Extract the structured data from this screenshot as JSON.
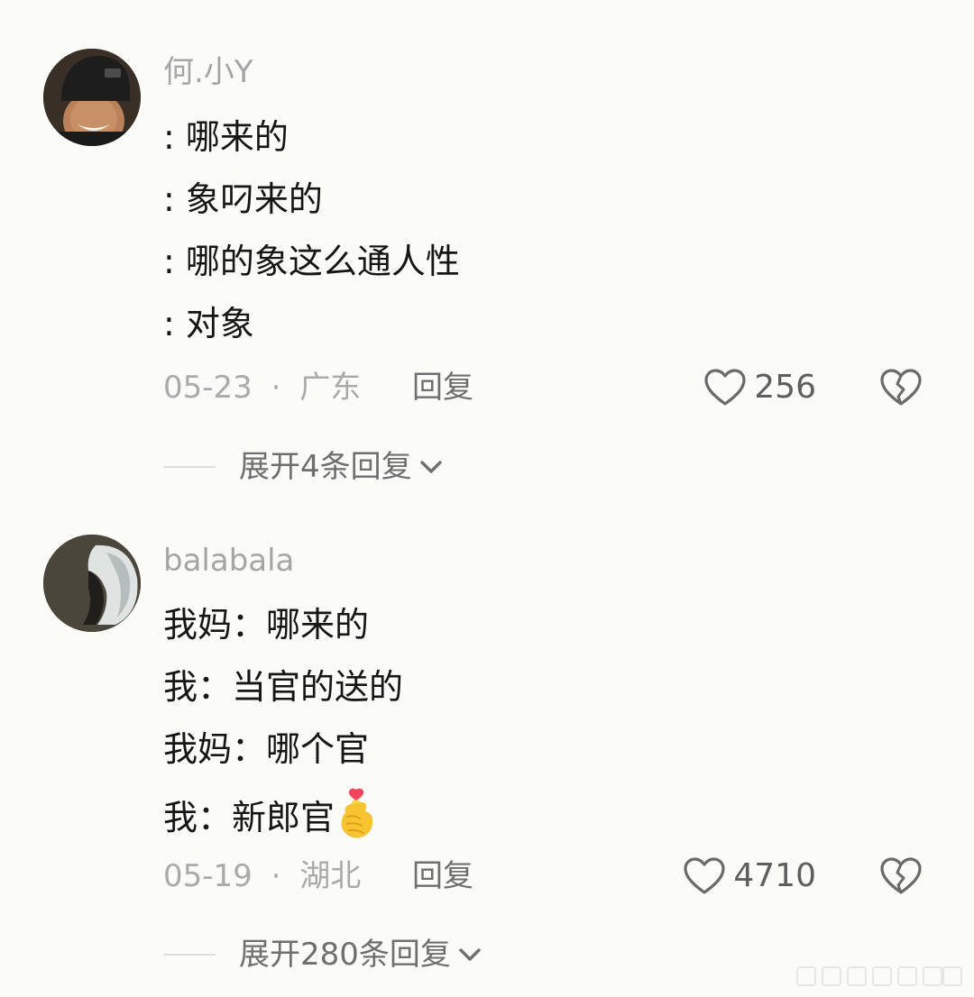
{
  "comments": [
    {
      "username": "何.小Y",
      "lines": [
        ":  哪来的",
        ":  象叼来的",
        ":  哪的象这么通人性",
        ":  对象"
      ],
      "date": "05-23",
      "separator": "·",
      "location": "广东",
      "reply_label": "回复",
      "like_count": "256",
      "expand_label": "展开4条回复"
    },
    {
      "username": "balabala",
      "lines": [
        "我妈：哪来的",
        "我：当官的送的",
        "我妈：哪个官",
        "我：新郎官"
      ],
      "date": "05-19",
      "separator": "·",
      "location": "湖北",
      "reply_label": "回复",
      "like_count": "4710",
      "expand_label": "展开280条回复"
    }
  ],
  "icons": {
    "like": "heart-outline-icon",
    "dislike": "broken-heart-icon",
    "expand": "chevron-down-icon",
    "emoji": "finger-heart-emoji"
  },
  "colors": {
    "background": "#fbfbf8",
    "text": "#161616",
    "muted": "#aaaaaa",
    "action": "#6f6f6f"
  }
}
